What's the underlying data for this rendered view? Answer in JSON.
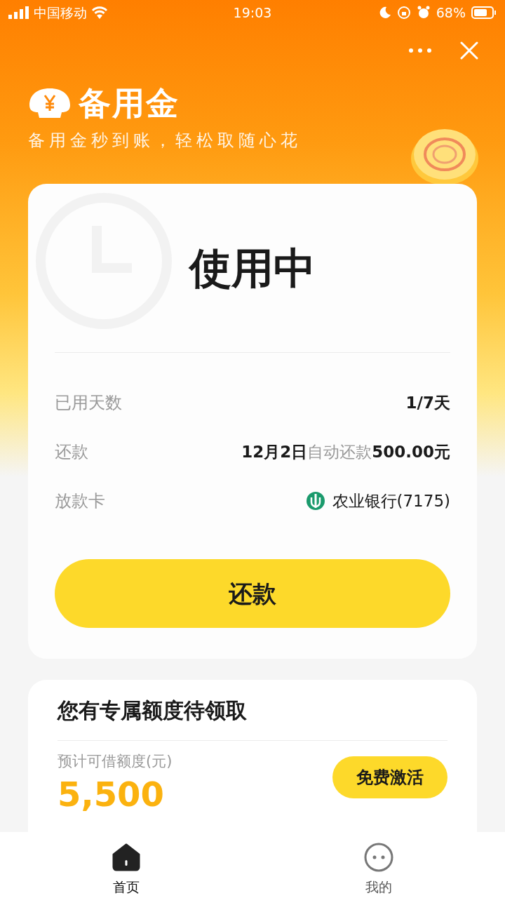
{
  "status_bar": {
    "carrier": "中国移动",
    "time": "19:03",
    "battery": "68%"
  },
  "header": {
    "title": "备用金",
    "subtitle": "备用金秒到账，轻松取随心花"
  },
  "status_card": {
    "status": "使用中",
    "rows": [
      {
        "label": "已用天数",
        "value": "1/7天",
        "kind": "plain"
      },
      {
        "label": "还款",
        "value": "**12月2日**自动还款**500.00元**",
        "kind": "rich"
      },
      {
        "label": "放款卡",
        "value": "农业银行(7175)",
        "kind": "bank"
      }
    ],
    "button": "还款"
  },
  "offer_card": {
    "title": "您有专属额度待领取",
    "label": "预计可借额度(元)",
    "amount": "5,500",
    "button": "免费激活"
  },
  "tabs": [
    {
      "label": "首页",
      "selected": true,
      "kind": "home"
    },
    {
      "label": "我的",
      "selected": false,
      "kind": "profile"
    }
  ]
}
